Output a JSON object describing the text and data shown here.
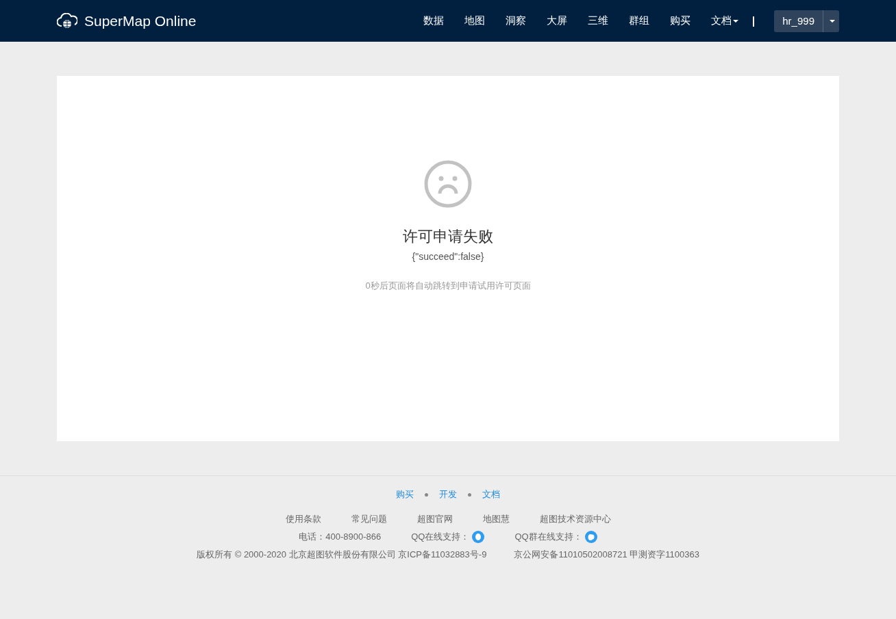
{
  "header": {
    "brand": "SuperMap Online",
    "nav": [
      {
        "label": "数据",
        "dropdown": false
      },
      {
        "label": "地图",
        "dropdown": false
      },
      {
        "label": "洞察",
        "dropdown": false
      },
      {
        "label": "大屏",
        "dropdown": false
      },
      {
        "label": "三维",
        "dropdown": false
      },
      {
        "label": "群组",
        "dropdown": false
      },
      {
        "label": "购买",
        "dropdown": false
      },
      {
        "label": "文档",
        "dropdown": true
      }
    ],
    "separator": "|",
    "user": "hr_999"
  },
  "message": {
    "title": "许可申请失败",
    "detail": "{\"succeed\":false}",
    "redirect": "0秒后页面将自动跳转到申请试用许可页面"
  },
  "footer": {
    "links": [
      "购买",
      "开发",
      "文档"
    ],
    "secondary_links": [
      "使用条款",
      "常见问题",
      "超图官网",
      "地图慧",
      "超图技术资源中心"
    ],
    "contacts": [
      {
        "kind": "text",
        "label": "电话：400-8900-866"
      },
      {
        "kind": "qq",
        "label": "QQ在线支持："
      },
      {
        "kind": "qq-group",
        "label": "QQ群在线支持："
      }
    ],
    "legal": [
      "版权所有 © 2000-2020 北京超图软件股份有限公司 京ICP备11032883号-9",
      "京公网安备11010502008721 甲测资字1100363"
    ]
  }
}
